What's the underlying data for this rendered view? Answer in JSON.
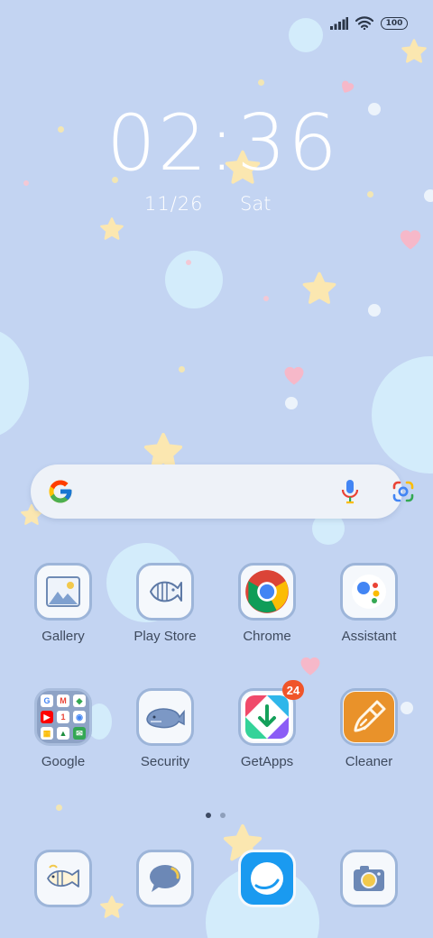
{
  "status_bar": {
    "battery": "100"
  },
  "clock": {
    "time": "02:36",
    "date": "11/26",
    "day": "Sat"
  },
  "search": {
    "brand_letter": "G"
  },
  "apps": [
    {
      "label": "Gallery"
    },
    {
      "label": "Play Store"
    },
    {
      "label": "Chrome"
    },
    {
      "label": "Assistant"
    },
    {
      "label": "Google"
    },
    {
      "label": "Security"
    },
    {
      "label": "GetApps",
      "badge": "24"
    },
    {
      "label": "Cleaner"
    }
  ],
  "folder_icons": [
    "G",
    "M",
    "◆",
    "▶",
    "1",
    "◉",
    "▦",
    "▲",
    "✉"
  ],
  "pager": {
    "pages": 2,
    "current": 1
  },
  "colors": {
    "wallpaper": "#c3d4f2",
    "tile_border": "#9db5d9",
    "badge": "#f0552a",
    "star": "#fbe7b0",
    "heart": "#f6b8c9"
  }
}
